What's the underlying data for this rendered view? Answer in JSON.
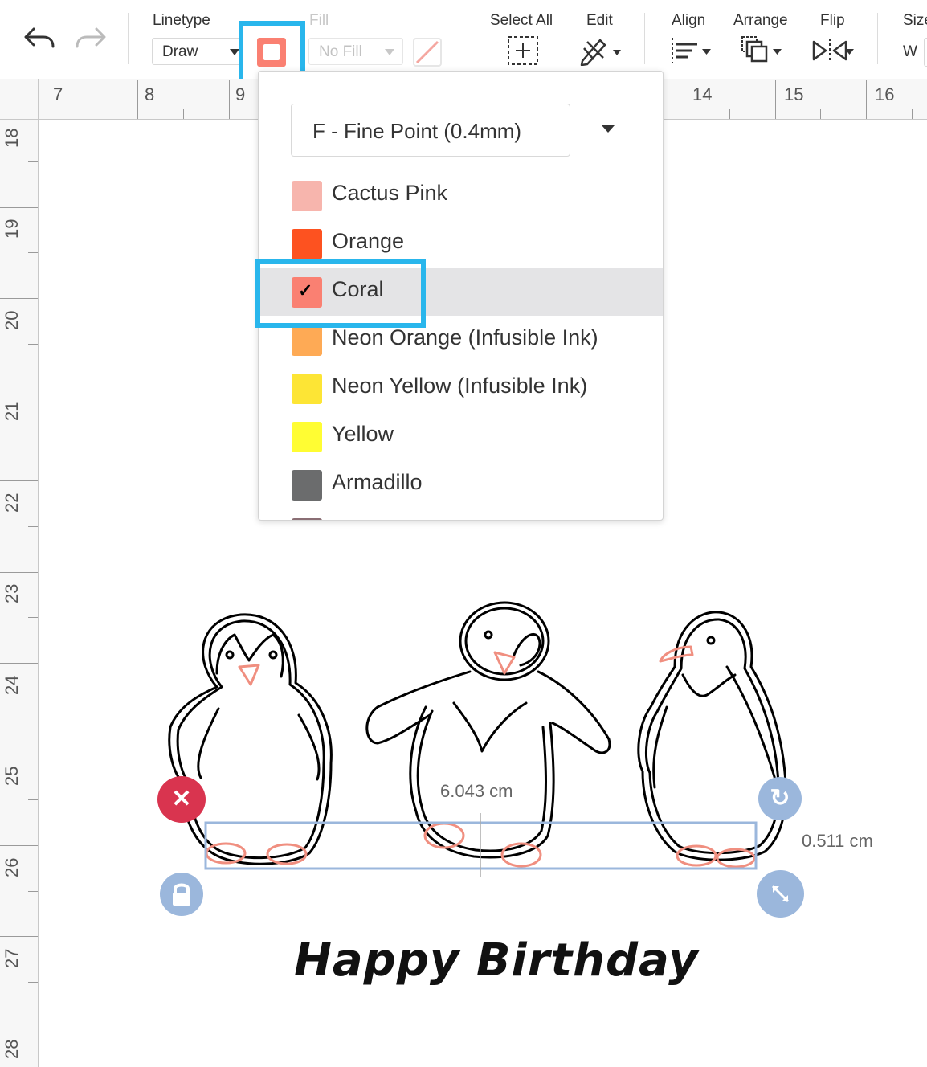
{
  "toolbar": {
    "linetype_label": "Linetype",
    "linetype_value": "Draw",
    "fill_label": "Fill",
    "fill_value": "No Fill",
    "select_all_label": "Select All",
    "edit_label": "Edit",
    "align_label": "Align",
    "arrange_label": "Arrange",
    "flip_label": "Flip",
    "size_label": "Size",
    "size_w_label": "W",
    "pen_color": "#fa8072",
    "highlight_color": "#29b6ec"
  },
  "ruler": {
    "horizontal": [
      "7",
      "8",
      "9",
      "14",
      "15",
      "16"
    ],
    "vertical": [
      "18",
      "19",
      "20",
      "21",
      "22",
      "23",
      "24",
      "25",
      "26",
      "27",
      "28"
    ]
  },
  "pen_dropdown": {
    "pen_type": "F - Fine Point (0.4mm)",
    "colors": [
      {
        "name": "Cactus Pink",
        "hex": "#f7b5ad",
        "selected": false
      },
      {
        "name": "Orange",
        "hex": "#fd5220",
        "selected": false
      },
      {
        "name": "Coral",
        "hex": "#fa8072",
        "selected": true
      },
      {
        "name": "Neon Orange (Infusible Ink)",
        "hex": "#feaa55",
        "selected": false
      },
      {
        "name": "Neon Yellow (Infusible Ink)",
        "hex": "#fde535",
        "selected": false
      },
      {
        "name": "Yellow",
        "hex": "#fffd33",
        "selected": false
      },
      {
        "name": "Armadillo",
        "hex": "#6b6c6d",
        "selected": false
      }
    ]
  },
  "canvas": {
    "width_dimension": "6.043 cm",
    "height_dimension": "0.511 cm",
    "greeting": "Happy Birthday",
    "selection_color": "#9bb7dc",
    "stroke_color": "#000000",
    "feet_color": "#f08f80"
  }
}
